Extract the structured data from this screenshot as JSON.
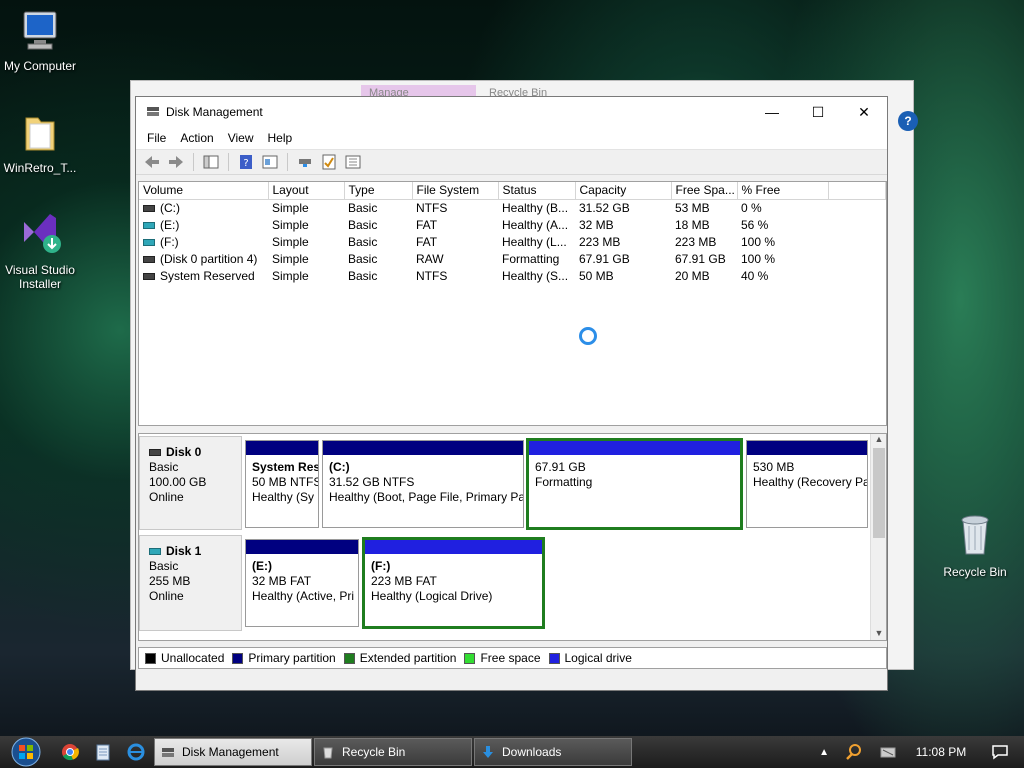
{
  "desktop": {
    "icons": [
      {
        "label": "My Computer"
      },
      {
        "label": "WinRetro_T..."
      },
      {
        "label": "Visual Studio Installer"
      },
      {
        "label": "Recycle Bin"
      }
    ]
  },
  "background_window": {
    "tab1": "Manage",
    "tab2": "Recycle Bin"
  },
  "window": {
    "title": "Disk Management",
    "minimize": "—",
    "maximize": "☐",
    "close": "✕"
  },
  "menu": [
    "File",
    "Action",
    "View",
    "Help"
  ],
  "volume_table": {
    "columns": [
      "Volume",
      "Layout",
      "Type",
      "File System",
      "Status",
      "Capacity",
      "Free Spa...",
      "% Free"
    ],
    "rows": [
      {
        "volume": "(C:)",
        "layout": "Simple",
        "type": "Basic",
        "fs": "NTFS",
        "status": "Healthy (B...",
        "capacity": "31.52 GB",
        "free": "53 MB",
        "pct": "0 %"
      },
      {
        "volume": "(E:)",
        "layout": "Simple",
        "type": "Basic",
        "fs": "FAT",
        "status": "Healthy (A...",
        "capacity": "32 MB",
        "free": "18 MB",
        "pct": "56 %"
      },
      {
        "volume": "(F:)",
        "layout": "Simple",
        "type": "Basic",
        "fs": "FAT",
        "status": "Healthy (L...",
        "capacity": "223 MB",
        "free": "223 MB",
        "pct": "100 %"
      },
      {
        "volume": "(Disk 0 partition 4)",
        "layout": "Simple",
        "type": "Basic",
        "fs": "RAW",
        "status": "Formatting",
        "capacity": "67.91 GB",
        "free": "67.91 GB",
        "pct": "100 %"
      },
      {
        "volume": "System Reserved",
        "layout": "Simple",
        "type": "Basic",
        "fs": "NTFS",
        "status": "Healthy (S...",
        "capacity": "50 MB",
        "free": "20 MB",
        "pct": "40 %"
      }
    ]
  },
  "disks": [
    {
      "name": "Disk 0",
      "kind": "Basic",
      "size": "100.00 GB",
      "state": "Online",
      "partitions": [
        {
          "name": "System Res",
          "line1": "50 MB NTFS",
          "line2": "Healthy (Sy"
        },
        {
          "name": "(C:)",
          "line1": "31.52 GB NTFS",
          "line2": "Healthy (Boot, Page File, Primary Pa"
        },
        {
          "name": "",
          "line1": "67.91 GB",
          "line2": "Formatting"
        },
        {
          "name": "",
          "line1": "530 MB",
          "line2": "Healthy (Recovery Pa"
        }
      ]
    },
    {
      "name": "Disk 1",
      "kind": "Basic",
      "size": "255 MB",
      "state": "Online",
      "partitions": [
        {
          "name": "(E:)",
          "line1": "32 MB FAT",
          "line2": "Healthy (Active, Pri"
        },
        {
          "name": "(F:)",
          "line1": "223 MB FAT",
          "line2": "Healthy (Logical Drive)"
        }
      ]
    }
  ],
  "legend": [
    {
      "label": "Unallocated",
      "color": "#000000"
    },
    {
      "label": "Primary partition",
      "color": "#000080"
    },
    {
      "label": "Extended partition",
      "color": "#1f7d1f"
    },
    {
      "label": "Free space",
      "color": "#33dd33"
    },
    {
      "label": "Logical drive",
      "color": "#2020e0"
    }
  ],
  "colors": {
    "primary": "#000080",
    "logical": "#2020e0",
    "selected_border": "#1f7d1f"
  },
  "taskbar": {
    "buttons": [
      "Disk Management",
      "Recycle Bin",
      "Downloads"
    ],
    "clock": "11:08 PM"
  }
}
